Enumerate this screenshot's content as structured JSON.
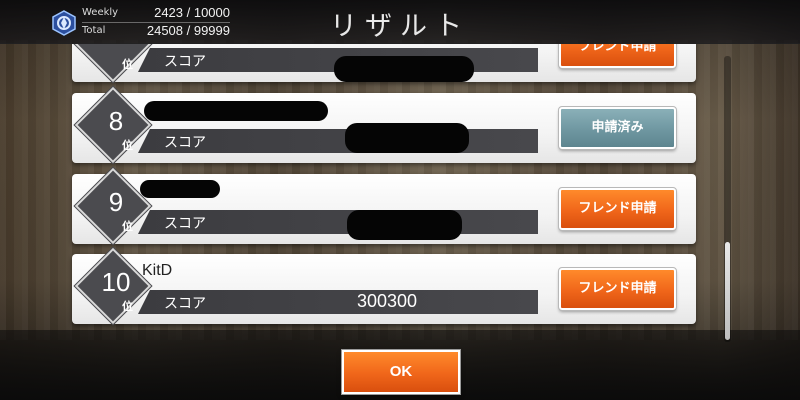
{
  "header": {
    "title": "リザルト",
    "points_icon": "crest-icon",
    "weekly_label": "Weekly",
    "weekly_value": "2423 /  10000",
    "total_label": "Total",
    "total_value": "24508 /  99999"
  },
  "rank_suffix": "位",
  "score_label": "スコア",
  "rows": [
    {
      "rank": "",
      "name": "",
      "score": "",
      "button": "フレンド申請"
    },
    {
      "rank": "8",
      "name": "",
      "score": "",
      "button": "申請済み"
    },
    {
      "rank": "9",
      "name": "",
      "score": "",
      "button": "フレンド申請"
    },
    {
      "rank": "10",
      "name": "KitD",
      "score": "300300",
      "button": "フレンド申請"
    }
  ],
  "footer": {
    "ok_label": "OK"
  },
  "colors": {
    "accent": "#f0661a",
    "requested": "#6f97a1"
  }
}
